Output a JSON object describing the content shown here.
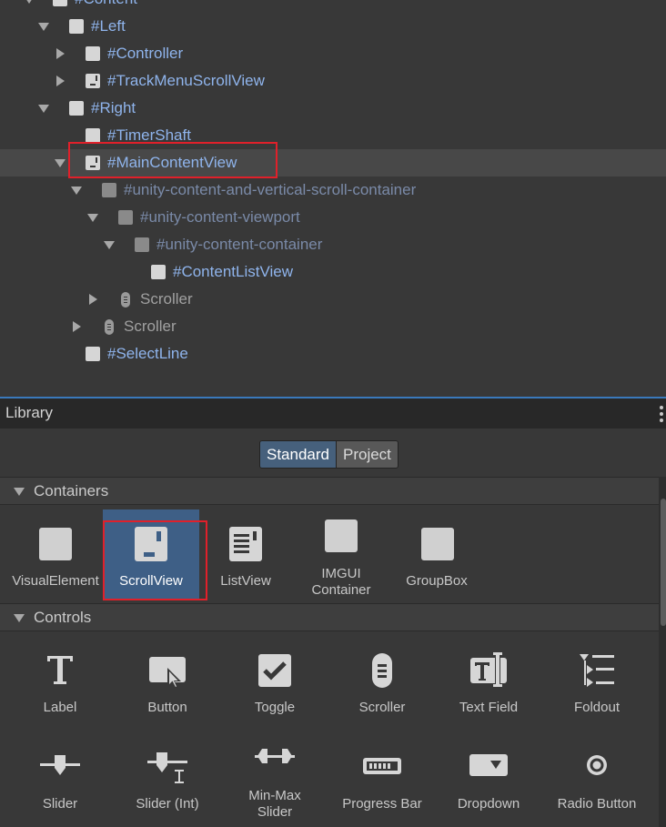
{
  "hierarchy": {
    "rows": [
      {
        "label": "#Content"
      },
      {
        "label": "#Left"
      },
      {
        "label": "#Controller"
      },
      {
        "label": "#TrackMenuScrollView"
      },
      {
        "label": "#Right"
      },
      {
        "label": "#TimerShaft"
      },
      {
        "label": "#MainContentView"
      },
      {
        "label": "#unity-content-and-vertical-scroll-container"
      },
      {
        "label": "#unity-content-viewport"
      },
      {
        "label": "#unity-content-container"
      },
      {
        "label": "#ContentListView"
      },
      {
        "label": "Scroller"
      },
      {
        "label": "Scroller"
      },
      {
        "label": "#SelectLine"
      }
    ]
  },
  "library": {
    "title": "Library",
    "tabs": [
      "Standard",
      "Project"
    ],
    "active_tab": "Standard",
    "containers": {
      "label": "Containers",
      "items": [
        {
          "label": "VisualElement",
          "icon": "visual-element-icon"
        },
        {
          "label": "ScrollView",
          "icon": "scroll-view-icon"
        },
        {
          "label": "ListView",
          "icon": "list-view-icon"
        },
        {
          "label": "IMGUI",
          "label2": "Container",
          "icon": "imgui-container-icon"
        },
        {
          "label": "GroupBox",
          "icon": "group-box-icon"
        }
      ]
    },
    "controls": {
      "label": "Controls",
      "items": [
        {
          "label": "Label",
          "icon": "label-icon"
        },
        {
          "label": "Button",
          "icon": "button-icon"
        },
        {
          "label": "Toggle",
          "icon": "toggle-icon"
        },
        {
          "label": "Scroller",
          "icon": "scroller-icon"
        },
        {
          "label": "Text Field",
          "icon": "text-field-icon"
        },
        {
          "label": "Foldout",
          "icon": "foldout-icon"
        },
        {
          "label": "Slider",
          "icon": "slider-icon"
        },
        {
          "label": "Slider (Int)",
          "icon": "slider-int-icon"
        },
        {
          "label": "Min-Max",
          "label2": "Slider",
          "icon": "min-max-slider-icon"
        },
        {
          "label": "Progress Bar",
          "icon": "progress-bar-icon"
        },
        {
          "label": "Dropdown",
          "icon": "dropdown-icon"
        },
        {
          "label": "Radio Button",
          "icon": "radio-button-icon"
        }
      ]
    }
  },
  "colors": {
    "panel": "#383838",
    "element_name": "#8fb4ec",
    "selection_tile": "#3e5f86",
    "highlight_box": "#e0202a",
    "divider": "#3a79bb"
  }
}
